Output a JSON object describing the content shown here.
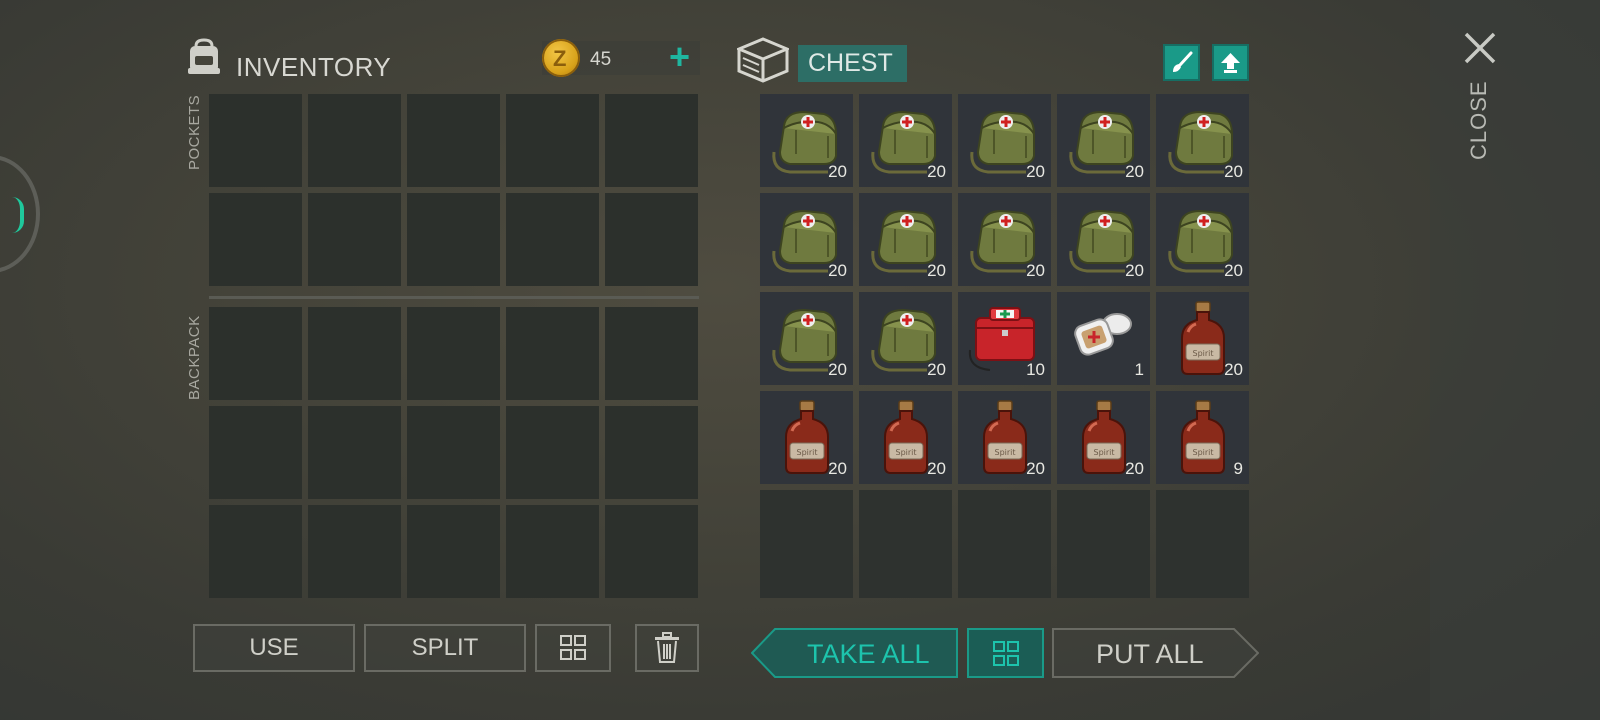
{
  "inventory": {
    "title": "INVENTORY",
    "coins": "45",
    "pockets_label": "POCKETS",
    "backpack_label": "BACKPACK"
  },
  "chest": {
    "title": "CHEST",
    "items": [
      {
        "icon": "medical-bag-icon",
        "qty": "20"
      },
      {
        "icon": "medical-bag-icon",
        "qty": "20"
      },
      {
        "icon": "medical-bag-icon",
        "qty": "20"
      },
      {
        "icon": "medical-bag-icon",
        "qty": "20"
      },
      {
        "icon": "medical-bag-icon",
        "qty": "20"
      },
      {
        "icon": "medical-bag-icon",
        "qty": "20"
      },
      {
        "icon": "medical-bag-icon",
        "qty": "20"
      },
      {
        "icon": "medical-bag-icon",
        "qty": "20"
      },
      {
        "icon": "medical-bag-icon",
        "qty": "20"
      },
      {
        "icon": "medical-bag-icon",
        "qty": "20"
      },
      {
        "icon": "medical-bag-icon",
        "qty": "20"
      },
      {
        "icon": "medical-bag-icon",
        "qty": "20"
      },
      {
        "icon": "first-aid-kit-icon",
        "qty": "10"
      },
      {
        "icon": "bandage-icon",
        "qty": "1"
      },
      {
        "icon": "spirit-bottle-icon",
        "qty": "20",
        "label": "Spirit"
      },
      {
        "icon": "spirit-bottle-icon",
        "qty": "20",
        "label": "Spirit"
      },
      {
        "icon": "spirit-bottle-icon",
        "qty": "20",
        "label": "Spirit"
      },
      {
        "icon": "spirit-bottle-icon",
        "qty": "20",
        "label": "Spirit"
      },
      {
        "icon": "spirit-bottle-icon",
        "qty": "20",
        "label": "Spirit"
      },
      {
        "icon": "spirit-bottle-icon",
        "qty": "9",
        "label": "Spirit"
      }
    ]
  },
  "buttons": {
    "use": "USE",
    "split": "SPLIT",
    "take_all": "TAKE ALL",
    "put_all": "PUT ALL",
    "close": "CLOSE"
  },
  "colors": {
    "accent": "#1dc4ad",
    "accent_dark": "#2d6e66",
    "cell": "#2c302c"
  }
}
